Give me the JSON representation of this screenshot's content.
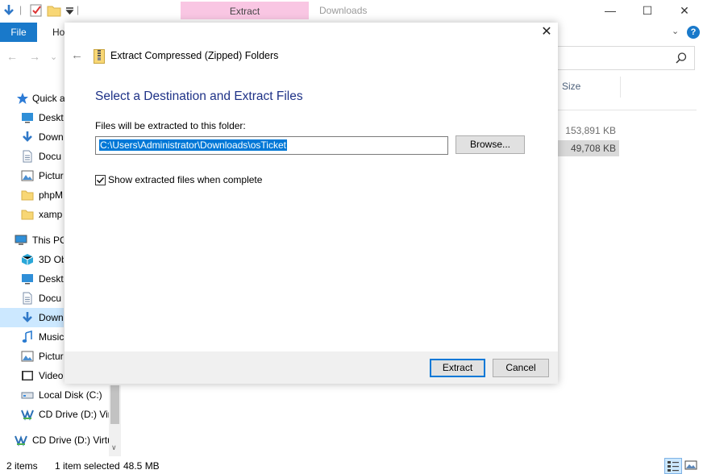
{
  "window": {
    "contextual_tab": "Extract",
    "title": "Downloads",
    "min_glyph": "—",
    "max_glyph": "☐",
    "close_glyph": "✕"
  },
  "ribbon": {
    "file_label": "File",
    "home_label": "Ho",
    "expand_glyph": "⌄",
    "help_glyph": "?"
  },
  "navigation": {
    "back_glyph": "←",
    "forward_glyph": "→",
    "recent_glyph": "⌄",
    "up_glyph": "↑"
  },
  "file_list": {
    "column_size": "Size",
    "sizes": [
      "153,891 KB",
      "49,708 KB"
    ]
  },
  "nav_pane": {
    "items": [
      {
        "label": "Quick a",
        "icon": "star-icon",
        "color": "#2c7bd6"
      },
      {
        "label": "Deskto",
        "icon": "desktop-icon",
        "color": "#2f8fd8"
      },
      {
        "label": "Down",
        "icon": "download-arrow-icon",
        "color": "#2f78c8"
      },
      {
        "label": "Docu",
        "icon": "document-icon",
        "color": "#7a8ea8"
      },
      {
        "label": "Pictur",
        "icon": "pictures-icon",
        "color": "#4a8ed0"
      },
      {
        "label": "phpM",
        "icon": "folder-icon",
        "color": "#f8d775"
      },
      {
        "label": "xamp",
        "icon": "folder-icon",
        "color": "#f8d775"
      },
      {
        "label": "This PC",
        "icon": "computer-icon",
        "color": "#2f8fd8"
      },
      {
        "label": "3D Ob",
        "icon": "cube-icon",
        "color": "#2aa7d8"
      },
      {
        "label": "Deskto",
        "icon": "desktop-icon",
        "color": "#2f8fd8"
      },
      {
        "label": "Docu",
        "icon": "document-icon",
        "color": "#7a8ea8"
      },
      {
        "label": "Down",
        "icon": "download-arrow-icon",
        "color": "#2f78c8"
      },
      {
        "label": "Music",
        "icon": "music-note-icon",
        "color": "#2a7bd0"
      },
      {
        "label": "Pictur",
        "icon": "pictures-icon",
        "color": "#4a8ed0"
      },
      {
        "label": "Video",
        "icon": "video-icon",
        "color": "#333333"
      },
      {
        "label": "Local Disk (C:)",
        "icon": "drive-icon",
        "color": "#6d7f95"
      },
      {
        "label": "CD Drive (D:) Virt",
        "icon": "cd-drive-icon",
        "color": "#2a6fb5"
      },
      {
        "label": "CD Drive (D:) Virtu",
        "icon": "cd-drive-icon",
        "color": "#2a6fb5"
      }
    ]
  },
  "status_bar": {
    "item_count": "2 items",
    "selection": "1 item selected",
    "selection_size": "48.5 MB"
  },
  "dialog": {
    "close_glyph": "✕",
    "back_glyph": "←",
    "title": "Extract Compressed (Zipped) Folders",
    "heading": "Select a Destination and Extract Files",
    "destination_label": "Files will be extracted to this folder:",
    "destination_path": "C:\\Users\\Administrator\\Downloads\\osTicket",
    "browse_label": "Browse...",
    "show_files_label": "Show extracted files when complete",
    "show_files_checked": true,
    "check_glyph": "✓",
    "extract_label": "Extract",
    "cancel_label": "Cancel"
  },
  "colors": {
    "accent": "#0078d7",
    "file_tab": "#1979ca",
    "heading": "#1e3287",
    "contextual_tab": "#f9c6e3"
  }
}
